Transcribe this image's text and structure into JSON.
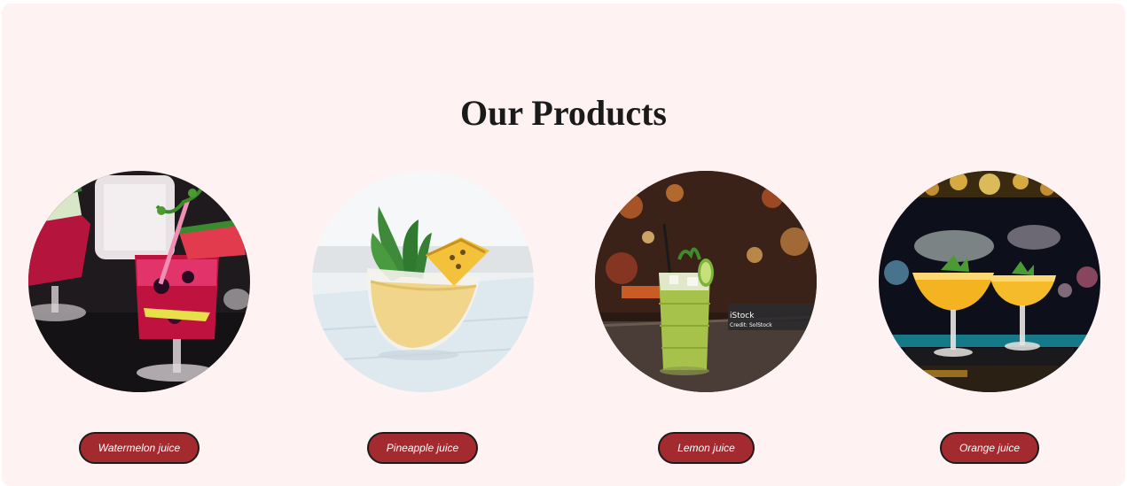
{
  "section": {
    "title": "Our Products",
    "background": "#fff2f2",
    "button_color": "#a32a2e"
  },
  "products": [
    {
      "label": "Watermelon juice",
      "image": "watermelon-juice-photo"
    },
    {
      "label": "Pineapple juice",
      "image": "pineapple-juice-photo"
    },
    {
      "label": "Lemon juice",
      "image": "lemon-juice-photo"
    },
    {
      "label": "Orange juice",
      "image": "orange-juice-photo"
    }
  ],
  "watermark": {
    "brand": "iStock",
    "credit": "Credit: SolStock"
  }
}
